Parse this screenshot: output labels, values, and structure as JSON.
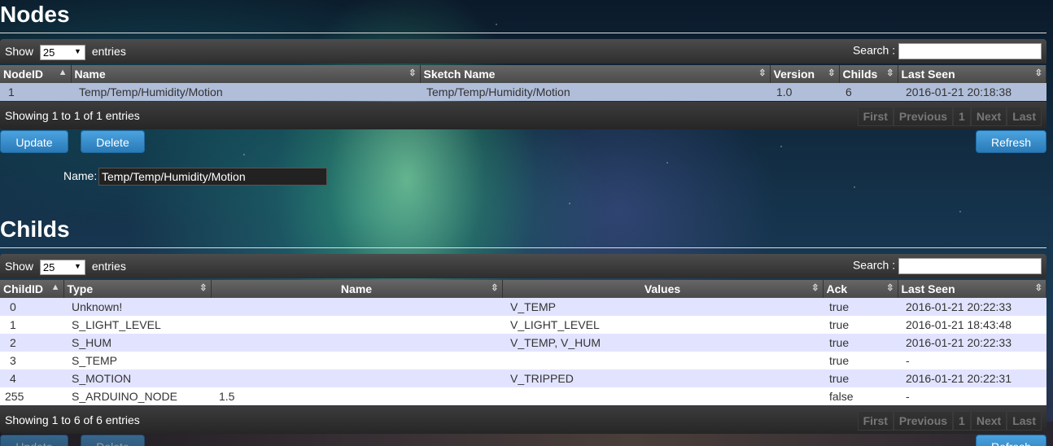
{
  "nodes": {
    "title": "Nodes",
    "show_label": "Show",
    "entries_value": "25",
    "entries_label": "entries",
    "search_label": "Search :",
    "columns": [
      "NodeID",
      "Name",
      "Sketch Name",
      "Version",
      "Childs",
      "Last Seen"
    ],
    "rows": [
      {
        "id": "1",
        "name": "Temp/Temp/Humidity/Motion",
        "sketch": "Temp/Temp/Humidity/Motion",
        "version": "1.0",
        "childs": "6",
        "last_seen": "2016-01-21 20:18:38"
      }
    ],
    "info": "Showing 1 to 1 of 1 entries",
    "pager": [
      "First",
      "Previous",
      "1",
      "Next",
      "Last"
    ],
    "buttons": {
      "update": "Update",
      "delete": "Delete",
      "refresh": "Refresh"
    },
    "name_label": "Name:",
    "name_value": "Temp/Temp/Humidity/Motion"
  },
  "childs": {
    "title": "Childs",
    "show_label": "Show",
    "entries_value": "25",
    "entries_label": "entries",
    "search_label": "Search :",
    "columns": [
      "ChildID",
      "Type",
      "Name",
      "Values",
      "Ack",
      "Last Seen"
    ],
    "rows": [
      {
        "id": "0",
        "type": "Unknown!",
        "name": "",
        "values": "V_TEMP",
        "ack": "true",
        "last_seen": "2016-01-21 20:22:33"
      },
      {
        "id": "1",
        "type": "S_LIGHT_LEVEL",
        "name": "",
        "values": "V_LIGHT_LEVEL",
        "ack": "true",
        "last_seen": "2016-01-21 18:43:48"
      },
      {
        "id": "2",
        "type": "S_HUM",
        "name": "",
        "values": "V_TEMP, V_HUM",
        "ack": "true",
        "last_seen": "2016-01-21 20:22:33"
      },
      {
        "id": "3",
        "type": "S_TEMP",
        "name": "",
        "values": "",
        "ack": "true",
        "last_seen": "-"
      },
      {
        "id": "4",
        "type": "S_MOTION",
        "name": "",
        "values": "V_TRIPPED",
        "ack": "true",
        "last_seen": "2016-01-21 20:22:31"
      },
      {
        "id": "255",
        "type": "S_ARDUINO_NODE",
        "name": "1.5",
        "values": "",
        "ack": "false",
        "last_seen": "-"
      }
    ],
    "info": "Showing 1 to 6 of 6 entries",
    "pager": [
      "First",
      "Previous",
      "1",
      "Next",
      "Last"
    ],
    "buttons": {
      "update": "Update",
      "delete": "Delete",
      "refresh": "Refresh"
    }
  },
  "colors": {
    "button": "#2a7ab8",
    "row_odd": "#e2e4ff",
    "row_selected": "#b0bed9"
  },
  "icons": {
    "sort_asc": "sort-asc-icon",
    "sort_both": "sort-both-icon",
    "dropdown": "dropdown-caret-icon"
  }
}
